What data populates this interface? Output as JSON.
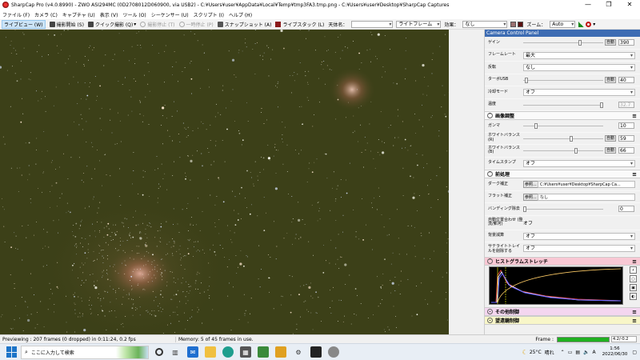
{
  "window": {
    "title": "SharpCap Pro (v4.0.8990) - ZWO ASI294MC (0D2708012D060900, via USB2) - C:¥Users¥user¥AppData¥Local¥Temp¥tmp3FA3.tmp.png - C:¥Users¥user¥Desktop¥SharpCap Captures",
    "minimize": "—",
    "maximize": "❐",
    "close": "✕"
  },
  "menu": [
    "ファイル (F)",
    "カメラ (C)",
    "キャプチャ (U)",
    "表示 (V)",
    "ツール (O)",
    "シーケンサー (U)",
    "スクリプト (I)",
    "ヘルプ (H)"
  ],
  "toolbar": {
    "live_view": "ライブビュー (W)",
    "start_capture": "撮影開始 (S)",
    "quick_capture": "クイック撮影 (Q)",
    "stop_capture": "撮影停止 (T)",
    "pause": "一時停止 (P)",
    "snapshot": "スナップショット (A)",
    "live_stack": "ライブスタック (L)",
    "object_name_label": "天体名：",
    "object_name_value": "",
    "live_frame": "ライトフレーム",
    "effect_label": "効果：",
    "effect_value": "なし",
    "zoom_label": "ズーム：",
    "zoom_value": "Auto"
  },
  "panel": {
    "header": "Camera Control Panel",
    "camera_rows": [
      {
        "label": "ゲイン",
        "auto": "自動",
        "value": "390",
        "level": 0.72
      },
      {
        "label": "フレームレート",
        "select": "最大"
      },
      {
        "label": "反転",
        "select": "なし"
      },
      {
        "label": "ターボUSB",
        "auto": "自動",
        "value": "40",
        "level": 0.02
      },
      {
        "label": "冷却モード",
        "select": "オフ"
      },
      {
        "label": "温度",
        "value": "32.7",
        "level": 1.0,
        "disabled": true
      }
    ],
    "image_section": {
      "title": "画像調整",
      "rows": [
        {
          "label": "ガンマ",
          "value": "10",
          "level": 0.15
        },
        {
          "label": "ホワイトバランス(R)",
          "auto": "自動",
          "value": "59",
          "level": 0.6
        },
        {
          "label": "ホワイトバランス(B)",
          "auto": "自動",
          "value": "66",
          "level": 0.67
        },
        {
          "label": "タイムスタンプ",
          "select": "オフ"
        }
      ]
    },
    "preprocess_section": {
      "title": "前処理",
      "rows": [
        {
          "label": "ダーク補正",
          "browse": "参照...",
          "path": "C:¥Users¥user¥Desktop¥SharpCap Ca..."
        },
        {
          "label": "フラット補正",
          "browse": "参照...",
          "path": "なし"
        },
        {
          "label": "バンディング除去",
          "value": "0",
          "level": 0.0
        },
        {
          "label": "自動位置合わせ (整流/郵河)",
          "text": "オフ"
        },
        {
          "label": "背景減算",
          "select": "オフ"
        },
        {
          "label": "サテライトトレイルを削除する",
          "select": "オフ"
        }
      ]
    },
    "histogram_title": "ヒストグラムストレッチ",
    "other_title": "その他制御",
    "scope_title": "望遠鏡制御"
  },
  "status": {
    "previewing": "Previewing : 207 frames (0 dropped) in 0:11:24, 0.2 fps",
    "memory": "Memory: 5 of 45 frames in use.",
    "frame_label": "Frame :",
    "frame_value": "4.2/-0.2",
    "frame_fill": 1.0
  },
  "taskbar": {
    "search_placeholder": "ここに入力して検索",
    "weather_temp": "25°C",
    "weather_text": "晴れ",
    "time": "1:56",
    "date": "2022/06/30"
  },
  "colors": {
    "accent": "#3d6cb3",
    "sky": "#3c4018",
    "histogram_header": "#f8c8d4"
  }
}
